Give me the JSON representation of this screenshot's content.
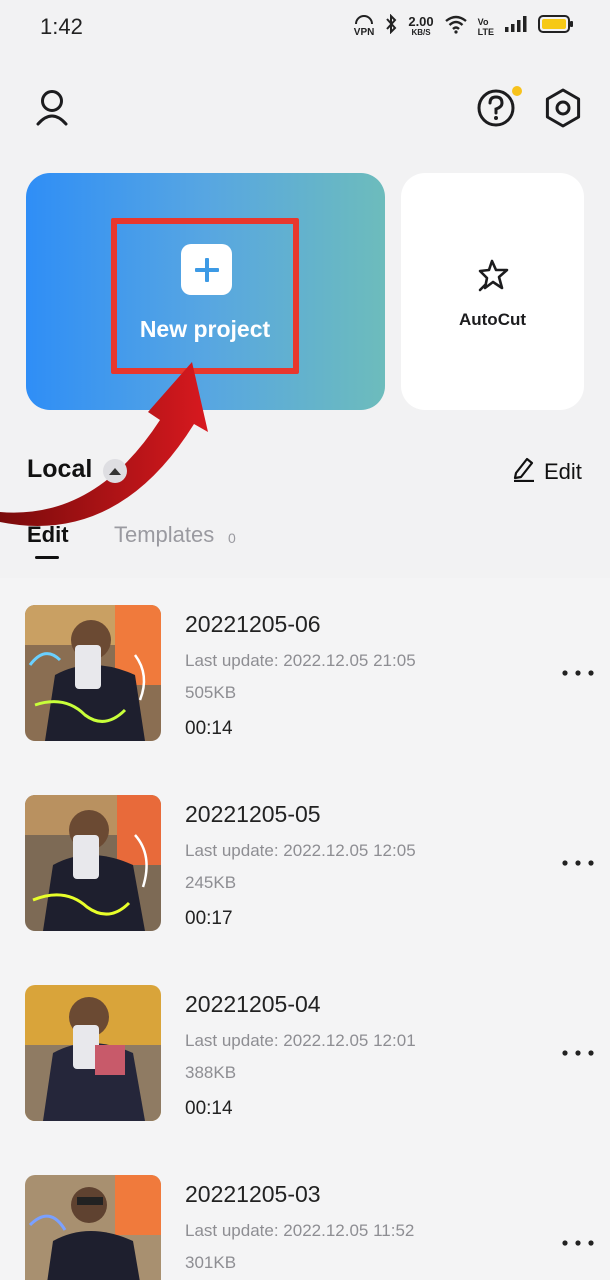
{
  "status_bar": {
    "time": "1:42",
    "vpn": "VPN",
    "net_speed": "2.00",
    "net_unit": "KB/S",
    "volte_top": "Vo",
    "volte_bottom": "LTE"
  },
  "header": {
    "profile_icon": "user-icon",
    "help_icon": "help-icon",
    "settings_icon": "gear-icon"
  },
  "cards": {
    "new_project": {
      "label": "New project",
      "icon": "plus-icon"
    },
    "autocut": {
      "label": "AutoCut",
      "icon": "sparkle-icon"
    }
  },
  "local": {
    "title": "Local",
    "edit_label": "Edit",
    "tabs": [
      {
        "label": "Edit",
        "active": true
      },
      {
        "label": "Templates",
        "count": "0",
        "active": false
      }
    ]
  },
  "projects": [
    {
      "name": "20221205-06",
      "updated": "Last update: 2022.12.05 21:05",
      "size": "505KB",
      "duration": "00:14"
    },
    {
      "name": "20221205-05",
      "updated": "Last update: 2022.12.05 12:05",
      "size": "245KB",
      "duration": "00:17"
    },
    {
      "name": "20221205-04",
      "updated": "Last update: 2022.12.05 12:01",
      "size": "388KB",
      "duration": "00:14"
    },
    {
      "name": "20221205-03",
      "updated": "Last update: 2022.12.05 11:52",
      "size": "301KB",
      "duration": ""
    }
  ],
  "colors": {
    "accent_gradient_start": "#2f8ef6",
    "accent_gradient_end": "#6dbcbc",
    "highlight": "#e8372d",
    "notification_dot": "#f7c21b"
  }
}
